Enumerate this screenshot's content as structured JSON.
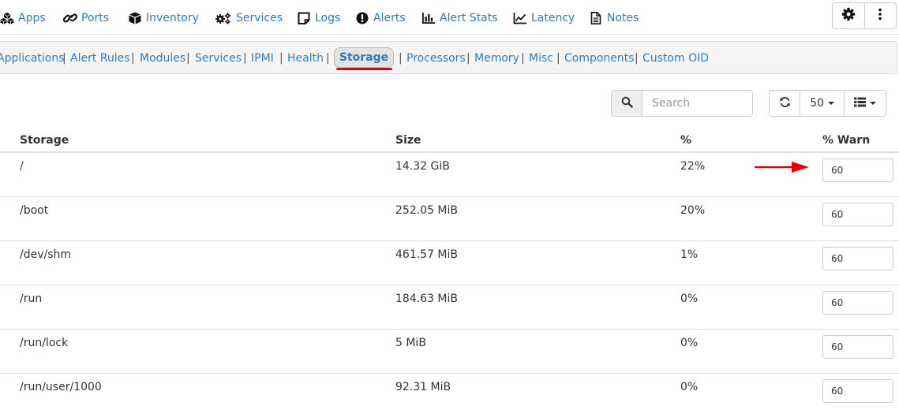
{
  "topnav": {
    "items": [
      {
        "label": "Apps",
        "icon": "cubes-icon"
      },
      {
        "label": "Ports",
        "icon": "link-icon"
      },
      {
        "label": "Inventory",
        "icon": "cube-icon"
      },
      {
        "label": "Services",
        "icon": "cogs-icon"
      },
      {
        "label": "Logs",
        "icon": "sticky-note-icon"
      },
      {
        "label": "Alerts",
        "icon": "exclamation-circle-icon"
      },
      {
        "label": "Alert Stats",
        "icon": "bar-chart-icon"
      },
      {
        "label": "Latency",
        "icon": "line-chart-icon"
      },
      {
        "label": "Notes",
        "icon": "file-text-icon"
      }
    ],
    "settings_icon": "gear-icon",
    "more_icon": "vertical-ellipsis-icon"
  },
  "subnav": {
    "items": [
      "Applications",
      "Alert Rules",
      "Modules",
      "Services",
      "IPMI",
      "Health",
      "Storage",
      "Processors",
      "Memory",
      "Misc",
      "Components",
      "Custom OID"
    ],
    "separator": "|",
    "active": "Storage",
    "active_underline_color": "#e0001a"
  },
  "toolbar": {
    "search_placeholder": "Search",
    "search_value": "",
    "page_size": "50",
    "refresh_icon": "refresh-icon",
    "columns_icon": "list-icon"
  },
  "table": {
    "columns": [
      "Storage",
      "Size",
      "%",
      "% Warn"
    ],
    "rows": [
      {
        "storage": "/",
        "size": "14.32 GiB",
        "percent": "22%",
        "warn": "60"
      },
      {
        "storage": "/boot",
        "size": "252.05 MiB",
        "percent": "20%",
        "warn": "60"
      },
      {
        "storage": "/dev/shm",
        "size": "461.57 MiB",
        "percent": "1%",
        "warn": "60"
      },
      {
        "storage": "/run",
        "size": "184.63 MiB",
        "percent": "0%",
        "warn": "60"
      },
      {
        "storage": "/run/lock",
        "size": "5 MiB",
        "percent": "0%",
        "warn": "60"
      },
      {
        "storage": "/run/user/1000",
        "size": "92.31 MiB",
        "percent": "0%",
        "warn": "60"
      }
    ]
  },
  "annotation": {
    "arrow_color": "#e60000",
    "points_to": "% Warn input of first row"
  },
  "colors": {
    "link": "#337ab7",
    "text": "#333333"
  }
}
